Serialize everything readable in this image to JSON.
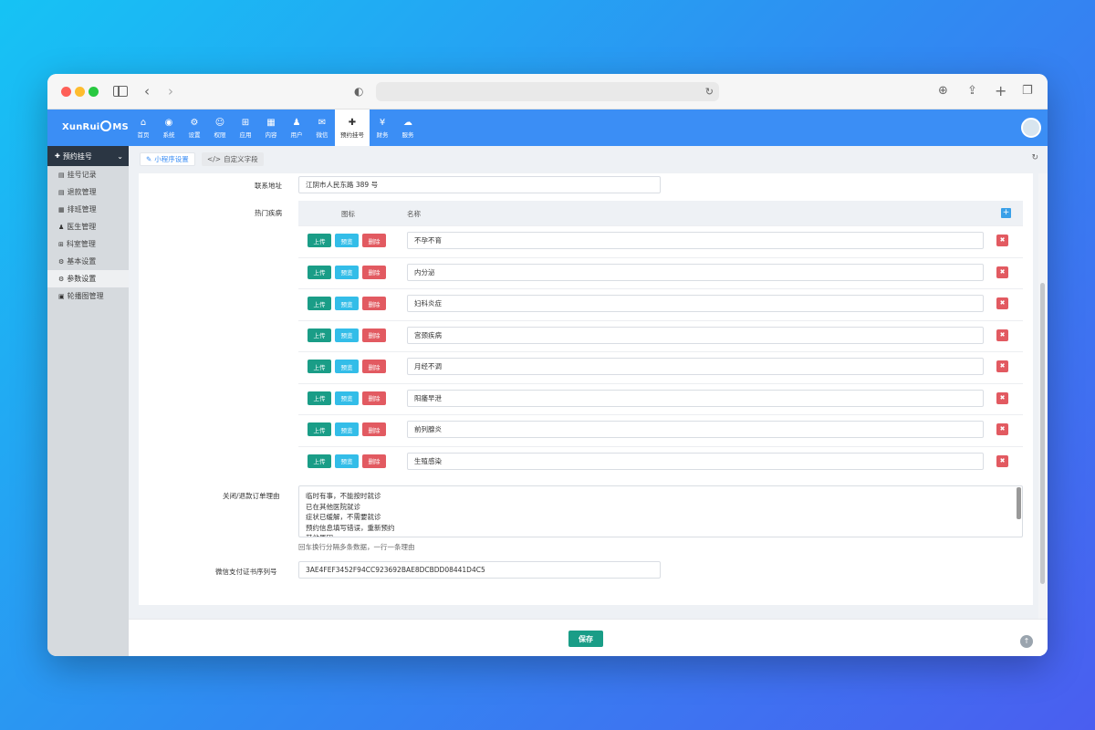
{
  "browser": {
    "address": ""
  },
  "logo": {
    "pre": "XunRui",
    "post": "MS"
  },
  "nav": {
    "items": [
      {
        "label": "首页",
        "icon": "home-icon",
        "glyph": "⌂"
      },
      {
        "label": "系统",
        "icon": "globe-icon",
        "glyph": "◉"
      },
      {
        "label": "设置",
        "icon": "gears-icon",
        "glyph": "⚙"
      },
      {
        "label": "权限",
        "icon": "user-circle-icon",
        "glyph": "☺"
      },
      {
        "label": "应用",
        "icon": "sitemap-icon",
        "glyph": "⊞"
      },
      {
        "label": "内容",
        "icon": "grid-icon",
        "glyph": "▦"
      },
      {
        "label": "用户",
        "icon": "user-icon",
        "glyph": "♟"
      },
      {
        "label": "微信",
        "icon": "wechat-icon",
        "glyph": "✉"
      },
      {
        "label": "预约挂号",
        "icon": "medkit-icon",
        "glyph": "✚",
        "active": true
      },
      {
        "label": "财务",
        "icon": "yen-icon",
        "glyph": "¥"
      },
      {
        "label": "服务",
        "icon": "cloud-icon",
        "glyph": "☁"
      }
    ]
  },
  "sidebar": {
    "title": "预约挂号",
    "items": [
      {
        "label": "挂号记录",
        "icon": "file-icon",
        "glyph": "▤"
      },
      {
        "label": "退款管理",
        "icon": "file-icon",
        "glyph": "▤"
      },
      {
        "label": "排班管理",
        "icon": "table-icon",
        "glyph": "▦"
      },
      {
        "label": "医生管理",
        "icon": "user-icon",
        "glyph": "♟"
      },
      {
        "label": "科室管理",
        "icon": "sitemap-icon",
        "glyph": "⊞"
      },
      {
        "label": "基本设置",
        "icon": "gear-icon",
        "glyph": "⚙"
      },
      {
        "label": "参数设置",
        "icon": "gear-icon",
        "glyph": "⚙",
        "active": true
      },
      {
        "label": "轮播图管理",
        "icon": "image-icon",
        "glyph": "▣"
      }
    ]
  },
  "tabs": [
    {
      "label": "小程序设置",
      "glyph": "✎"
    },
    {
      "label": "自定义字段",
      "glyph": "</>"
    }
  ],
  "form": {
    "address_label": "联系地址",
    "address_value": "江阴市人民东路 389 号",
    "diseases_label": "热门疾病",
    "col_icon": "图标",
    "col_name": "名称",
    "btn_upload": "上传",
    "btn_preview": "预览",
    "btn_delete": "删除",
    "diseases": [
      "不孕不育",
      "内分泌",
      "妇科炎症",
      "宫颈疾病",
      "月经不调",
      "阳痿早泄",
      "前列腺炎",
      "生殖感染"
    ],
    "reason_label": "关闭/退款订单理由",
    "reasons": [
      "临时有事，不能按时就诊",
      "已在其他医院就诊",
      "症状已缓解，不需要就诊",
      "预约信息填写错误，重新预约",
      "其他原因"
    ],
    "reason_hint": "回车换行分隔多条数据，一行一条理由",
    "cert_label": "微信支付证书序列号",
    "cert_value": "3AE4FEF3452F94CC923692BAE8DCBDD08441D4C5"
  },
  "footer": {
    "save_label": "保存"
  }
}
